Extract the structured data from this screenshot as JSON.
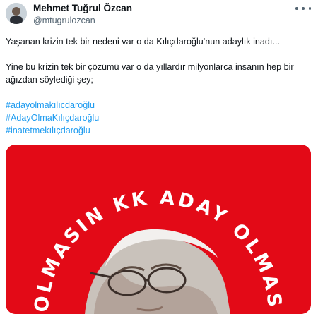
{
  "author": {
    "display_name": "Mehmet Tuğrul Özcan",
    "handle": "@mtugrulozcan"
  },
  "tweet": {
    "line1": "Yaşanan krizin tek bir nedeni var o da Kılıçdaroğlu'nun adaylık inadı...",
    "line2a": "Yine bu krizin tek bir çözümü var o da yıllardır milyonlarca insanın hep bir",
    "line2b": "ağızdan söylediği şey;",
    "hashtags": [
      "#adayolmakılıcdaroğlu",
      "#AdayOlmaKılıçdaroğlu",
      "#inatetmekılıçdaroğlu"
    ]
  },
  "media": {
    "arc_text": "Y OLMASIN KK ADAY OLMASIN",
    "background_color": "#e30a17",
    "text_color": "#ffffff"
  },
  "colors": {
    "hashtag": "#1d9bf0",
    "secondary_text": "#536471"
  },
  "icons": [
    "more-options-icon"
  ]
}
